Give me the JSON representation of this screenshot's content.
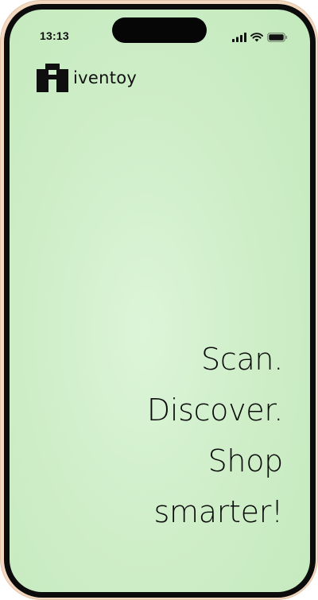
{
  "status_bar": {
    "time": "13:13",
    "icons": [
      "cellular-signal-icon",
      "wifi-icon",
      "battery-icon"
    ]
  },
  "brand": {
    "name": "iventoy",
    "logo_icon": "building-logo-icon"
  },
  "tagline": {
    "lines": [
      "Scan.",
      "Discover.",
      "Shop",
      "smarter!"
    ]
  },
  "colors": {
    "device_frame": "#f3d9c2",
    "bezel": "#0c0c0c",
    "screen_background": "#cfeec9",
    "text": "#0a0a0a"
  }
}
